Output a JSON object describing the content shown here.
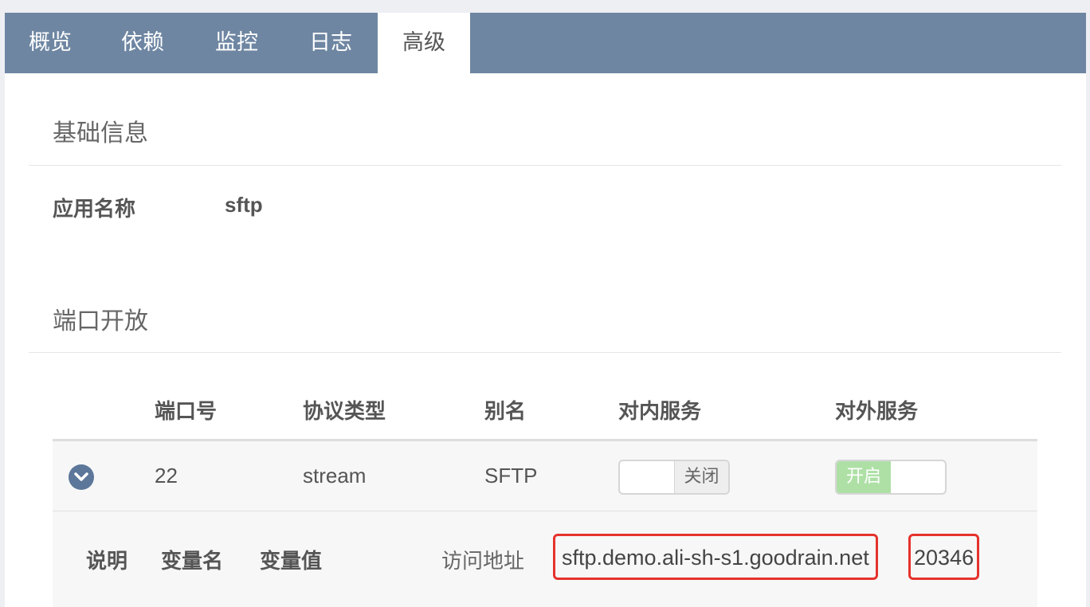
{
  "tabs": [
    {
      "label": "概览"
    },
    {
      "label": "依赖"
    },
    {
      "label": "监控"
    },
    {
      "label": "日志"
    },
    {
      "label": "高级"
    }
  ],
  "active_tab": "高级",
  "basic_info": {
    "title": "基础信息",
    "app_name_label": "应用名称",
    "app_name_value": "sftp"
  },
  "ports": {
    "title": "端口开放",
    "headers": {
      "port": "端口号",
      "protocol": "协议类型",
      "alias": "别名",
      "inner_service": "对内服务",
      "outer_service": "对外服务"
    },
    "rows": [
      {
        "port": "22",
        "protocol": "stream",
        "alias": "SFTP",
        "inner_service": {
          "label": "关闭",
          "state": "off"
        },
        "outer_service": {
          "label": "开启",
          "state": "on"
        }
      }
    ],
    "detail": {
      "col_desc": "说明",
      "col_var_name": "变量名",
      "col_var_value": "变量值",
      "access_label": "访问地址",
      "access_host": "sftp.demo.ali-sh-s1.goodrain.net",
      "access_port": "20346"
    }
  },
  "colors": {
    "tabbar": "#6e86a2",
    "highlight_border": "#e5322c",
    "toggle_on": "#aee0a6"
  }
}
